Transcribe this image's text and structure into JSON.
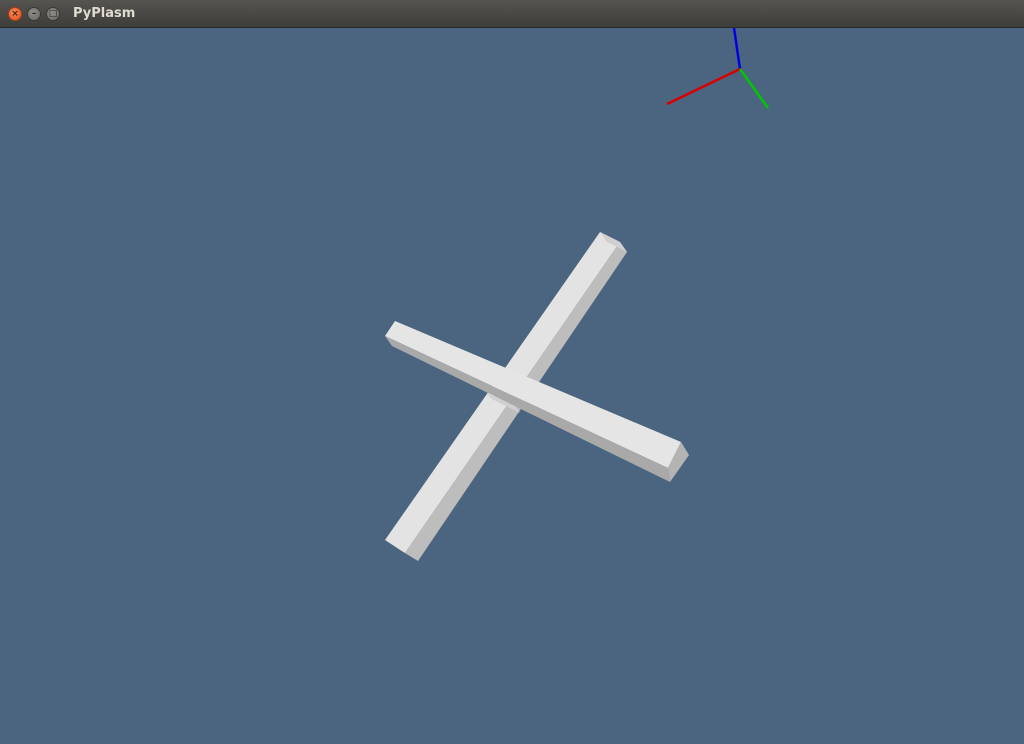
{
  "window": {
    "title": "PyPlasm",
    "buttons": {
      "close_glyph": "×",
      "minimize_glyph": "–",
      "maximize_glyph": "□"
    }
  },
  "viewport": {
    "background_color": "#4b6580",
    "axes_gizmo": {
      "x_axis_color": "#d90000",
      "y_axis_color": "#00c800",
      "z_axis_color": "#0000e6"
    },
    "model_color": "#e2e2e2"
  }
}
